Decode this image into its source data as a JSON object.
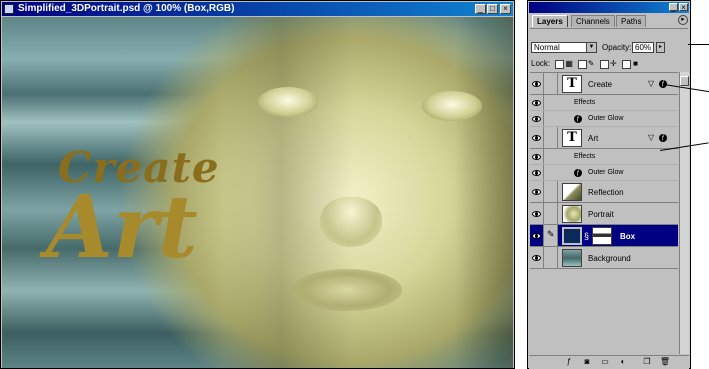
{
  "document": {
    "title": "Simplified_3DPortrait.psd @ 100% (Box,RGB)",
    "window_buttons": [
      "_",
      "□",
      "×"
    ],
    "artwork_text": {
      "line1": "Create",
      "line2": "Art"
    }
  },
  "layers_palette": {
    "tabs": [
      "Layers",
      "Channels",
      "Paths"
    ],
    "active_tab": "Layers",
    "blend_mode": "Normal",
    "opacity_label": "Opacity:",
    "opacity_value": "60%",
    "lock_label": "Lock:",
    "layers": [
      {
        "name": "Create",
        "type": "text",
        "thumb": "T",
        "effects_label": "Effects",
        "effect": "Outer Glow"
      },
      {
        "name": "Art",
        "type": "text",
        "thumb": "T",
        "effects_label": "Effects",
        "effect": "Outer Glow"
      },
      {
        "name": "Reflection",
        "type": "image"
      },
      {
        "name": "Portrait",
        "type": "image"
      },
      {
        "name": "Box",
        "type": "image",
        "selected": true
      },
      {
        "name": "Background",
        "type": "image"
      }
    ],
    "bottom_icons": [
      "layer-style-icon",
      "mask-icon",
      "new-set-icon",
      "adjustment-layer-icon",
      "new-layer-icon",
      "trash-icon"
    ],
    "selection_color": "#000080"
  },
  "colors": {
    "title_bar": "#000080",
    "artwork_gold": "#a68a2c"
  }
}
